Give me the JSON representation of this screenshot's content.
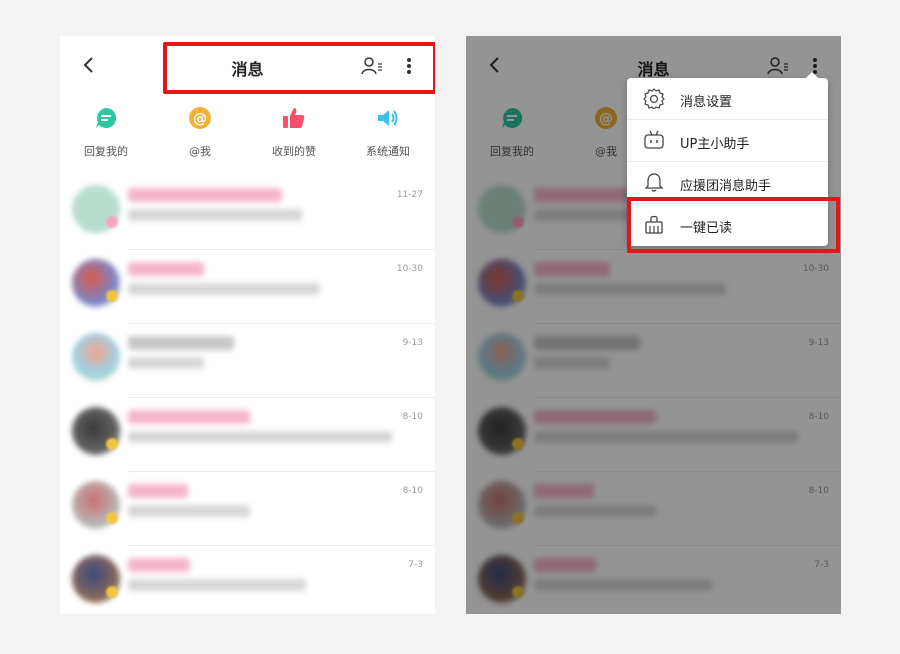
{
  "header": {
    "back_icon": "chevron-left-icon",
    "title": "消息",
    "contacts_icon": "contacts-list-icon",
    "more_icon": "more-vertical-icon"
  },
  "categories": [
    {
      "label": "回复我的",
      "icon": "reply-chat-icon",
      "color": "#2ec7a0"
    },
    {
      "label": "@我",
      "icon": "at-icon",
      "color": "#f2b13a"
    },
    {
      "label": "收到的赞",
      "icon": "thumbs-up-icon",
      "color": "#f5506c"
    },
    {
      "label": "系统通知",
      "icon": "speaker-icon",
      "color": "#3cc2e9"
    }
  ],
  "messages": [
    {
      "date": "11-27"
    },
    {
      "date": "10-30"
    },
    {
      "date": "9-13"
    },
    {
      "date": "8-10"
    },
    {
      "date": "8-10"
    },
    {
      "date": "7-3"
    }
  ],
  "menu": {
    "items": [
      {
        "label": "消息设置",
        "icon": "gear-icon"
      },
      {
        "label": "UP主小助手",
        "icon": "bilibili-tv-icon"
      },
      {
        "label": "应援团消息助手",
        "icon": "bell-icon"
      },
      {
        "label": "一键已读",
        "icon": "broom-icon"
      }
    ]
  },
  "colors": {
    "highlight": "#e3161c",
    "overlay": "rgba(0,0,0,0.42)"
  }
}
